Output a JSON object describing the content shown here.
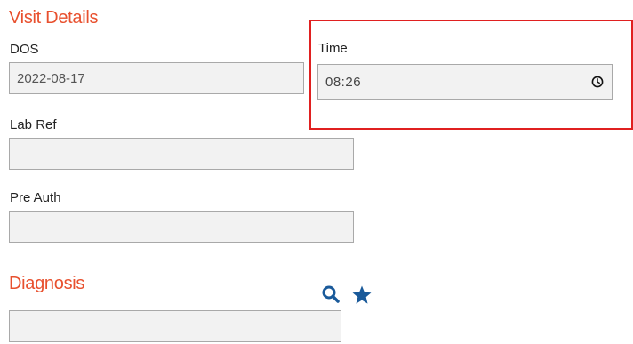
{
  "visit_details": {
    "title": "Visit Details",
    "dos": {
      "label": "DOS",
      "value": "2022-08-17"
    },
    "time": {
      "label": "Time",
      "value": "08:26"
    },
    "lab_ref": {
      "label": "Lab Ref",
      "value": ""
    },
    "pre_auth": {
      "label": "Pre Auth",
      "value": ""
    }
  },
  "diagnosis": {
    "title": "Diagnosis",
    "value": ""
  },
  "icons": {
    "clock": "clock-icon",
    "search": "search-icon",
    "star": "star-icon"
  },
  "colors": {
    "section_title": "#e8502e",
    "highlight": "#e02020",
    "icon_blue": "#1a5a9a",
    "field_bg": "#f2f2f2"
  }
}
